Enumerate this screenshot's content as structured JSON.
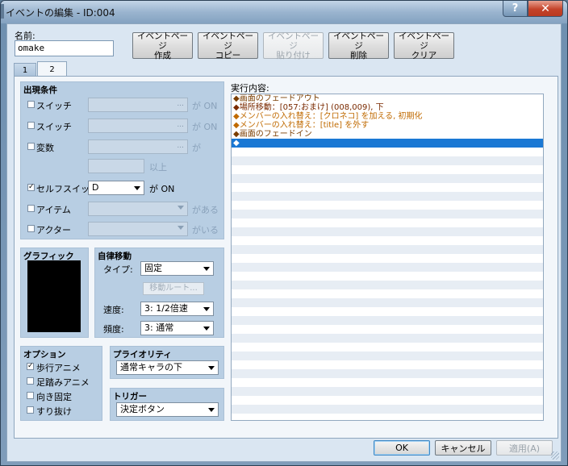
{
  "window": {
    "title": "イベントの編集 - ID:004",
    "help_label": "?",
    "close_label": "✕"
  },
  "name_field": {
    "label": "名前:",
    "value": "omake"
  },
  "page_buttons": [
    {
      "label": "イベントページ\n作成",
      "enabled": true
    },
    {
      "label": "イベントページ\nコピー",
      "enabled": true
    },
    {
      "label": "イベントページ\n貼り付け",
      "enabled": false
    },
    {
      "label": "イベントページ\n削除",
      "enabled": true
    },
    {
      "label": "イベントページ\nクリア",
      "enabled": true
    }
  ],
  "tabs": [
    {
      "label": "1",
      "active": false
    },
    {
      "label": "2",
      "active": true
    }
  ],
  "conditions": {
    "title": "出現条件",
    "switch1": {
      "label": "スイッチ",
      "checked": false,
      "suffix": "が ON",
      "dots": "..."
    },
    "switch2": {
      "label": "スイッチ",
      "checked": false,
      "suffix": "が ON",
      "dots": "..."
    },
    "variable": {
      "label": "変数",
      "checked": false,
      "suffix": "が",
      "dots": "...",
      "above_label": "以上"
    },
    "self_switch": {
      "label": "セルフスイッチ",
      "checked": true,
      "value": "D",
      "suffix": "が ON"
    },
    "item": {
      "label": "アイテム",
      "checked": false,
      "suffix": "がある"
    },
    "actor": {
      "label": "アクター",
      "checked": false,
      "suffix": "がいる"
    }
  },
  "graphic": {
    "title": "グラフィック"
  },
  "autonomous": {
    "title": "自律移動",
    "type_label": "タイプ:",
    "type_value": "固定",
    "route_button": "移動ルート...",
    "speed_label": "速度:",
    "speed_value": "3: 1/2倍速",
    "freq_label": "頻度:",
    "freq_value": "3: 通常"
  },
  "options": {
    "title": "オプション",
    "items": [
      {
        "label": "歩行アニメ",
        "checked": true
      },
      {
        "label": "足踏みアニメ",
        "checked": false
      },
      {
        "label": "向き固定",
        "checked": false
      },
      {
        "label": "すり抜け",
        "checked": false
      }
    ]
  },
  "priority": {
    "title": "プライオリティ",
    "value": "通常キャラの下"
  },
  "trigger": {
    "title": "トリガー",
    "value": "決定ボタン"
  },
  "contents": {
    "label": "実行内容:",
    "lines": [
      {
        "text": "◆画面のフェードアウト",
        "color": "#7a3d00"
      },
      {
        "text": "◆場所移動：[057:おまけ] (008,009), 下",
        "color": "#7a2a00"
      },
      {
        "text": "◆メンバーの入れ替え：[クロネコ] を加える, 初期化",
        "color": "#c06a00"
      },
      {
        "text": "◆メンバーの入れ替え：[title] を外す",
        "color": "#c06a00"
      },
      {
        "text": "◆画面のフェードイン",
        "color": "#7a3d00"
      },
      {
        "text": "◆",
        "color": "#ffffff"
      }
    ]
  },
  "footer": {
    "ok": "OK",
    "cancel": "キャンセル",
    "apply": "適用(A)"
  }
}
